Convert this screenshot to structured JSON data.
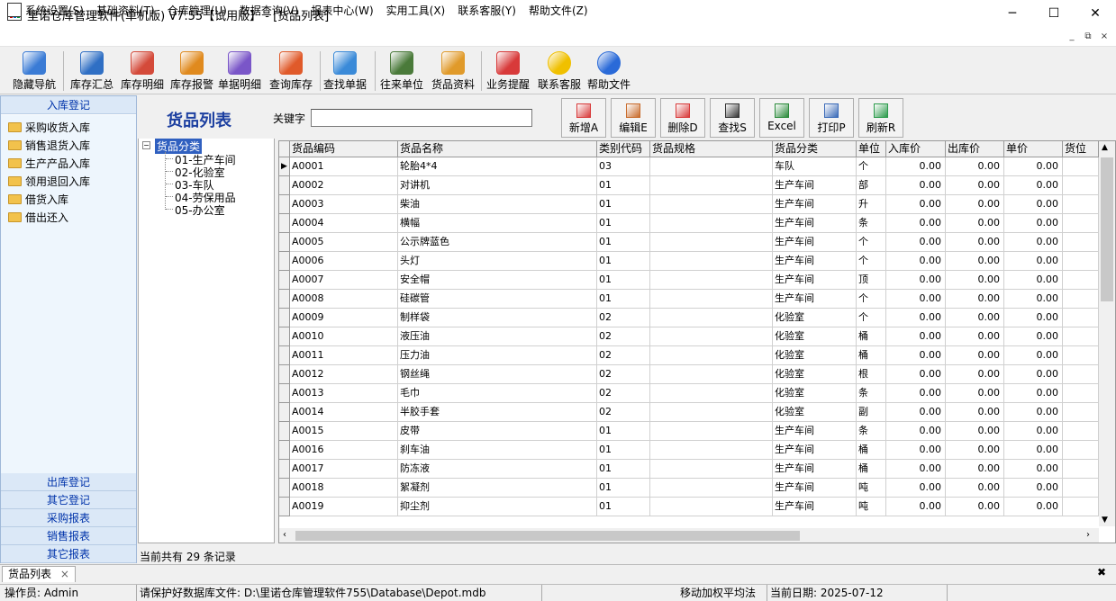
{
  "window": {
    "title": "里诺仓库管理软件(单机版) V7.55【试用版】 - [货品列表]",
    "minimize": "─",
    "maximize": "☐",
    "close": "✕"
  },
  "menu": [
    "系统设置(S)",
    "基础资料(T)",
    "仓库管理(U)",
    "数据查询(V)",
    "报表中心(W)",
    "实用工具(X)",
    "联系客服(Y)",
    "帮助文件(Z)"
  ],
  "mdi_controls": [
    "_",
    "⧉",
    "×"
  ],
  "toolbar": [
    {
      "label": "隐藏导航",
      "icon": "monitor-icon",
      "color": "#3a7bd5"
    },
    {
      "label": "库存汇总",
      "icon": "chart-summary-icon",
      "color": "#2f6fc4"
    },
    {
      "label": "库存明细",
      "icon": "bar-chart-icon",
      "color": "#d44a3a"
    },
    {
      "label": "库存报警",
      "icon": "alarm-icon",
      "color": "#e08a1e"
    },
    {
      "label": "单据明细",
      "icon": "documents-icon",
      "color": "#7a56c8"
    },
    {
      "label": "查询库存",
      "icon": "stock-query-icon",
      "color": "#e05a2a"
    },
    {
      "label": "查找单据",
      "icon": "find-document-icon",
      "color": "#3a8ad8"
    },
    {
      "label": "往来单位",
      "icon": "partners-icon",
      "color": "#4a7a3a"
    },
    {
      "label": "货品资料",
      "icon": "goods-box-icon",
      "color": "#e09a2a"
    },
    {
      "label": "业务提醒",
      "icon": "calendar-icon",
      "color": "#d83a3a"
    },
    {
      "label": "联系客服",
      "icon": "headset-icon",
      "color": "#f0c000"
    },
    {
      "label": "帮助文件",
      "icon": "help-icon",
      "color": "#2a6ad8"
    }
  ],
  "sidebar": {
    "top_header": "入库登记",
    "items": [
      "采购收货入库",
      "销售退货入库",
      "生产产品入库",
      "领用退回入库",
      "借货入库",
      "借出还入"
    ],
    "bottom_headers": [
      "出库登记",
      "其它登记",
      "采购报表",
      "销售报表",
      "其它报表"
    ]
  },
  "content": {
    "title": "货品列表",
    "keyword_label": "关键字",
    "keyword_value": "",
    "actions": [
      {
        "label": "新增A",
        "icon": "add-icon"
      },
      {
        "label": "编辑E",
        "icon": "edit-icon"
      },
      {
        "label": "删除D",
        "icon": "delete-icon"
      },
      {
        "label": "查找S",
        "icon": "binoculars-icon"
      },
      {
        "label": "Excel",
        "icon": "excel-icon"
      },
      {
        "label": "打印P",
        "icon": "print-icon"
      },
      {
        "label": "刷新R",
        "icon": "refresh-icon"
      }
    ],
    "tree": {
      "root": "货品分类",
      "children": [
        "01-生产车间",
        "02-化验室",
        "03-车队",
        "04-劳保用品",
        "05-办公室"
      ]
    },
    "table": {
      "headers": [
        "货品编码",
        "货品名称",
        "类别代码",
        "货品规格",
        "货品分类",
        "单位",
        "入库价",
        "出库价",
        "单价",
        "货位"
      ],
      "rows": [
        [
          "A0001",
          "轮胎4*4",
          "03",
          "",
          "车队",
          "个",
          "0.00",
          "0.00",
          "0.00",
          ""
        ],
        [
          "A0002",
          "对讲机",
          "01",
          "",
          "生产车间",
          "部",
          "0.00",
          "0.00",
          "0.00",
          ""
        ],
        [
          "A0003",
          "柴油",
          "01",
          "",
          "生产车间",
          "升",
          "0.00",
          "0.00",
          "0.00",
          ""
        ],
        [
          "A0004",
          "横幅",
          "01",
          "",
          "生产车间",
          "条",
          "0.00",
          "0.00",
          "0.00",
          ""
        ],
        [
          "A0005",
          "公示牌蓝色",
          "01",
          "",
          "生产车间",
          "个",
          "0.00",
          "0.00",
          "0.00",
          ""
        ],
        [
          "A0006",
          "头灯",
          "01",
          "",
          "生产车间",
          "个",
          "0.00",
          "0.00",
          "0.00",
          ""
        ],
        [
          "A0007",
          "安全帽",
          "01",
          "",
          "生产车间",
          "顶",
          "0.00",
          "0.00",
          "0.00",
          ""
        ],
        [
          "A0008",
          "硅碳管",
          "01",
          "",
          "生产车间",
          "个",
          "0.00",
          "0.00",
          "0.00",
          ""
        ],
        [
          "A0009",
          "制样袋",
          "02",
          "",
          "化验室",
          "个",
          "0.00",
          "0.00",
          "0.00",
          ""
        ],
        [
          "A0010",
          "液压油",
          "02",
          "",
          "化验室",
          "桶",
          "0.00",
          "0.00",
          "0.00",
          ""
        ],
        [
          "A0011",
          "压力油",
          "02",
          "",
          "化验室",
          "桶",
          "0.00",
          "0.00",
          "0.00",
          ""
        ],
        [
          "A0012",
          "钢丝绳",
          "02",
          "",
          "化验室",
          "根",
          "0.00",
          "0.00",
          "0.00",
          ""
        ],
        [
          "A0013",
          "毛巾",
          "02",
          "",
          "化验室",
          "条",
          "0.00",
          "0.00",
          "0.00",
          ""
        ],
        [
          "A0014",
          "半胶手套",
          "02",
          "",
          "化验室",
          "副",
          "0.00",
          "0.00",
          "0.00",
          ""
        ],
        [
          "A0015",
          "皮带",
          "01",
          "",
          "生产车间",
          "条",
          "0.00",
          "0.00",
          "0.00",
          ""
        ],
        [
          "A0016",
          "刹车油",
          "01",
          "",
          "生产车间",
          "桶",
          "0.00",
          "0.00",
          "0.00",
          ""
        ],
        [
          "A0017",
          "防冻液",
          "01",
          "",
          "生产车间",
          "桶",
          "0.00",
          "0.00",
          "0.00",
          ""
        ],
        [
          "A0018",
          "絮凝剂",
          "01",
          "",
          "生产车间",
          "吨",
          "0.00",
          "0.00",
          "0.00",
          ""
        ],
        [
          "A0019",
          "抑尘剂",
          "01",
          "",
          "生产车间",
          "吨",
          "0.00",
          "0.00",
          "0.00",
          ""
        ]
      ]
    },
    "record_info": "当前共有 29 条记录"
  },
  "tab": {
    "label": "货品列表",
    "close": "×"
  },
  "tabbar_close": "✖",
  "status": [
    "操作员: Admin",
    "请保护好数据库文件: D:\\里诺仓库管理软件755\\Database\\Depot.mdb",
    "移动加权平均法",
    "当前日期: 2025-07-12"
  ]
}
